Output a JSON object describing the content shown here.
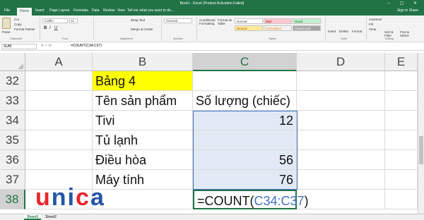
{
  "window": {
    "title": "Book1 - Excel (Product Activation Failed)",
    "controls": "– ▢ ✕"
  },
  "tabs": [
    "File",
    "Home",
    "Insert",
    "Page Layout",
    "Formulas",
    "Data",
    "Review",
    "View"
  ],
  "tell_me": "Tell me what you want to do...",
  "user_area": "Sign in  Share",
  "ribbon": {
    "clipboard": {
      "cut": "Cut",
      "copy": "Copy",
      "format_painter": "Format Painter",
      "paste": "Paste",
      "label": "Clipboard"
    },
    "font": {
      "name": "Calibri",
      "size": "11",
      "label": "Font"
    },
    "alignment": {
      "wrap": "Wrap Text",
      "merge": "Merge & Center",
      "label": "Alignment"
    },
    "number": {
      "format": "General",
      "label": "Number"
    },
    "styles": {
      "conditional": "Conditional Formatting",
      "format_table": "Format as Table",
      "normal": "Normal",
      "bad": "Bad",
      "good": "Good",
      "neutral": "Neutral",
      "calculation": "Calculation",
      "check_cell": "Check Cell",
      "label": "Styles"
    },
    "cells": {
      "insert": "Insert",
      "delete": "Delete",
      "format": "Format",
      "label": "Cells"
    },
    "editing": {
      "autosum": "AutoSum",
      "fill": "Fill",
      "clear": "Clear",
      "sort": "Sort & Filter",
      "find": "Find & Select",
      "label": "Editing"
    }
  },
  "formula_bar": {
    "name_box": "SUM",
    "icons": "✕ ✓ fx",
    "formula": "=COUNT(C34:C37)"
  },
  "columns": [
    "A",
    "B",
    "C",
    "D",
    "E"
  ],
  "rows": [
    "32",
    "33",
    "34",
    "35",
    "36",
    "37",
    "38"
  ],
  "cells": {
    "b32": "Bảng 4",
    "b33": "Tên sản phẩm",
    "c33": "Số lượng (chiếc)",
    "b34": "Tivi",
    "c34": "12",
    "b35": "Tủ lạnh",
    "b36": "Điều hòa",
    "c36": "56",
    "b37": "Máy tính",
    "c37": "76",
    "c38_prefix": "=COUNT(",
    "c38_ref": "C34:C37",
    "c38_suffix": ")"
  },
  "logo_text": "unica",
  "sheets": [
    "Sheet1",
    "Sheet2"
  ],
  "colors": {
    "excel_green": "#217346",
    "highlight_yellow": "#ffff00",
    "ref_blue": "#4472c4",
    "logo_red": "#e8262c",
    "logo_blue": "#2456a6"
  }
}
